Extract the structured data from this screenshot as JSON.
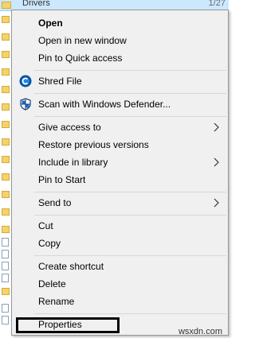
{
  "background_row": {
    "name": "Drivers",
    "date": "1/27"
  },
  "menu": {
    "items": [
      {
        "label": "Open",
        "bold": true
      },
      {
        "label": "Open in new window"
      },
      {
        "label": "Pin to Quick access"
      },
      {
        "label": "Shred File",
        "icon": "shred-icon"
      },
      {
        "label": "Scan with Windows Defender...",
        "icon": "windows-defender-icon"
      },
      {
        "label": "Give access to",
        "submenu": true
      },
      {
        "label": "Restore previous versions"
      },
      {
        "label": "Include in library",
        "submenu": true
      },
      {
        "label": "Pin to Start"
      },
      {
        "label": "Send to",
        "submenu": true
      },
      {
        "label": "Cut"
      },
      {
        "label": "Copy"
      },
      {
        "label": "Create shortcut"
      },
      {
        "label": "Delete"
      },
      {
        "label": "Rename"
      },
      {
        "label": "Properties",
        "highlighted": true
      }
    ]
  },
  "watermark": "wsxdn.com",
  "colors": {
    "menu_bg": "#f0f0f0",
    "menu_border": "#979797",
    "separator": "#d7d7d7",
    "selection_bg": "#cce8ff",
    "highlight_box": "#000000"
  }
}
